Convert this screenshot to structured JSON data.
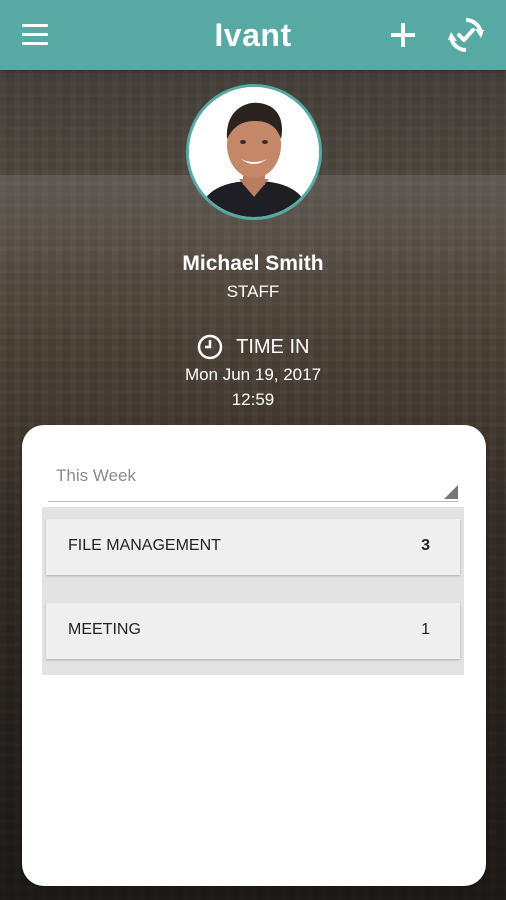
{
  "app": {
    "title": "Ivant"
  },
  "icons": {
    "menu": "menu-icon",
    "add": "plus-icon",
    "sync": "sync-icon",
    "clock": "clock-icon",
    "dropdown": "dropdown-triangle-icon"
  },
  "colors": {
    "accent": "#58a9a4",
    "card": "#ffffff"
  },
  "profile": {
    "name": "Michael Smith",
    "role": "STAFF"
  },
  "time_status": {
    "label": "TIME IN",
    "date": "Mon Jun 19, 2017",
    "time": "12:59"
  },
  "filter": {
    "selected": "This Week"
  },
  "activities": [
    {
      "label": "FILE MANAGEMENT",
      "count": "3"
    },
    {
      "label": "MEETING",
      "count": "1"
    }
  ]
}
